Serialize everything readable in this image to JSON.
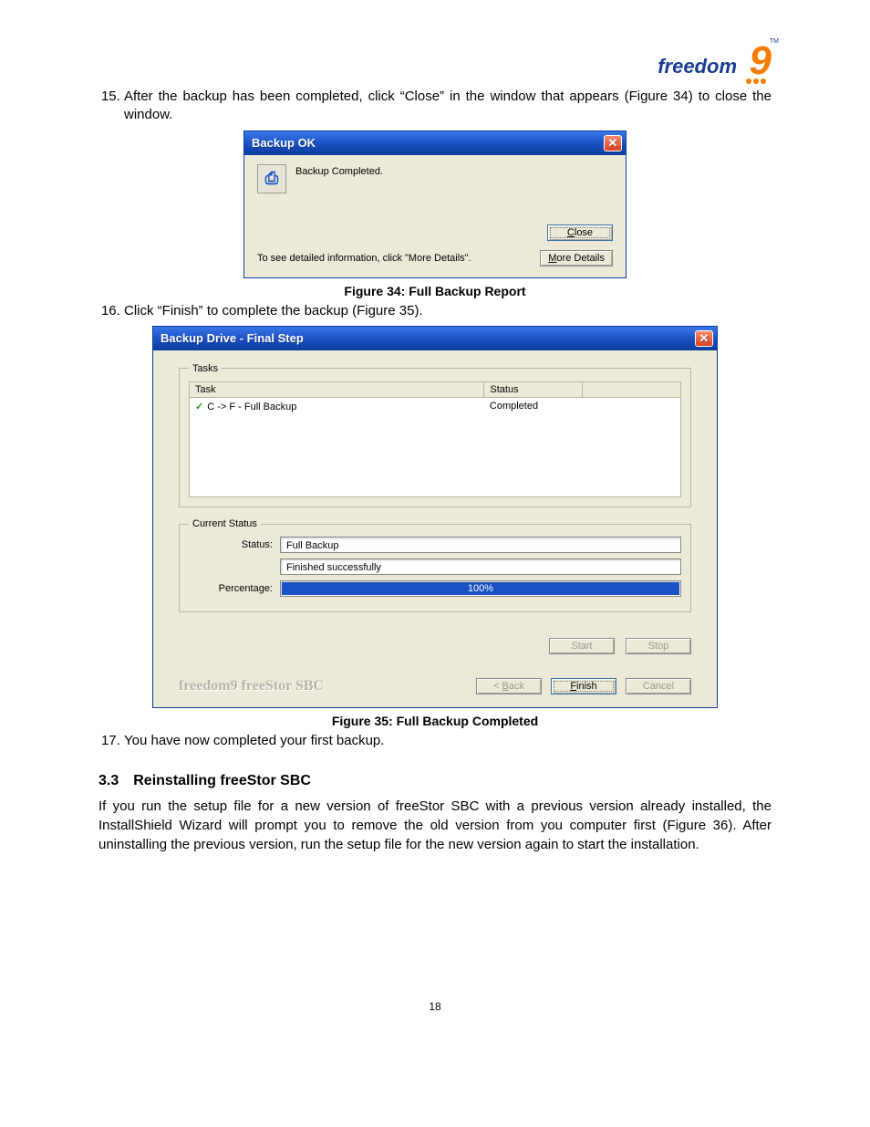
{
  "logo": {
    "word": "freedom",
    "nine": "9",
    "tm": "TM"
  },
  "step15": "After the backup has been completed, click “Close” in the window that appears (Figure 34) to close the window.",
  "dlg1": {
    "title": "Backup OK",
    "msg": "Backup Completed.",
    "info": "To see detailed information, click \"More Details\".",
    "close": "Close",
    "more": "More Details"
  },
  "fig34": "Figure 34: Full Backup Report",
  "step16": "Click “Finish” to complete the backup (Figure 35).",
  "dlg2": {
    "title": "Backup Drive - Final Step",
    "tasks_legend": "Tasks",
    "col_task": "Task",
    "col_status": "Status",
    "task_name": "C -> F - Full Backup",
    "task_status": "Completed",
    "cs_legend": "Current Status",
    "lbl_status": "Status:",
    "lbl_pct": "Percentage:",
    "val_status": "Full Backup",
    "val_result": "Finished successfully",
    "pct": "100%",
    "start": "Start",
    "stop": "Stop",
    "brand": "freedom9 freeStor SBC",
    "back": "< Back",
    "finish": "Finish",
    "cancel": "Cancel"
  },
  "fig35": "Figure 35: Full Backup Completed",
  "step17": "You have now completed your first backup.",
  "section": "3.3 Reinstalling freeStor SBC",
  "para": "If you run the setup file for a new version of freeStor SBC with a previous version already installed, the InstallShield Wizard will prompt you to remove the old version from you computer first (Figure 36).  After uninstalling the previous version, run the setup file for the new version again to start the installation.",
  "page": "18"
}
